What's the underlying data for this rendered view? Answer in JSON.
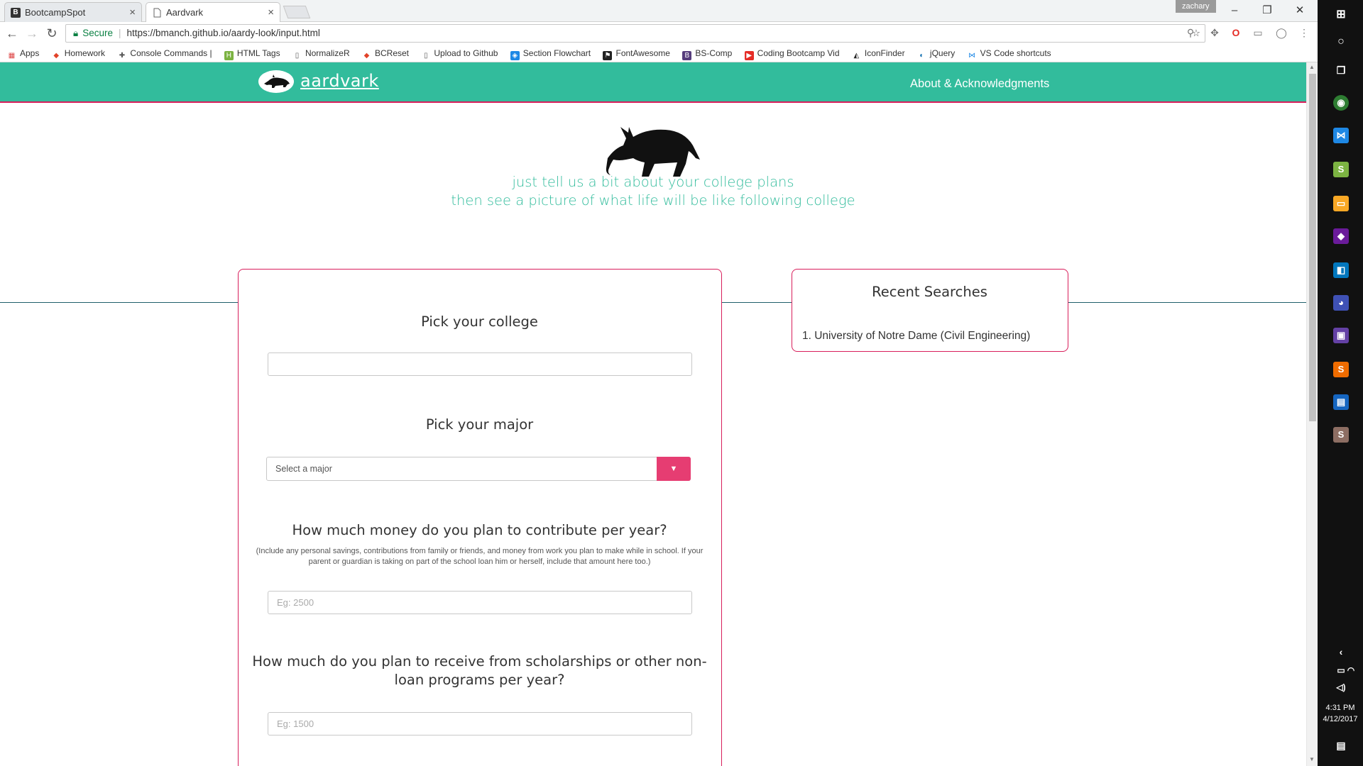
{
  "browser": {
    "tabs": [
      {
        "title": "BootcampSpot",
        "favicon": "B",
        "active": false
      },
      {
        "title": "Aardvark",
        "favicon": "page-icon",
        "active": true
      }
    ],
    "profile_name": "zachary",
    "address": {
      "secure_label": "Secure",
      "url": "https://bmanch.github.io/aardy-look/input.html"
    },
    "bookmarks": [
      {
        "label": "Apps",
        "icon": "apps-grid-icon",
        "color": "#d44"
      },
      {
        "label": "Homework",
        "icon": "gitlab-icon",
        "color": "#e24329"
      },
      {
        "label": "Console Commands |",
        "icon": "puzzle-icon",
        "color": "#555"
      },
      {
        "label": "HTML Tags",
        "icon": "html-icon",
        "color": "#7cb342"
      },
      {
        "label": "NormalizeR",
        "icon": "page-icon",
        "color": "#555"
      },
      {
        "label": "BCReset",
        "icon": "gitlab-icon",
        "color": "#e24329"
      },
      {
        "label": "Upload to Github",
        "icon": "page-icon",
        "color": "#555"
      },
      {
        "label": "Section Flowchart",
        "icon": "draw-icon",
        "color": "#1e88e5"
      },
      {
        "label": "FontAwesome",
        "icon": "flag-icon",
        "color": "#222"
      },
      {
        "label": "BS-Comp",
        "icon": "bootstrap-icon",
        "color": "#563d7c"
      },
      {
        "label": "Coding Bootcamp Vid",
        "icon": "youtube-icon",
        "color": "#e52d27"
      },
      {
        "label": "IconFinder",
        "icon": "iconfinder-icon",
        "color": "#222"
      },
      {
        "label": "jQuery",
        "icon": "jquery-icon",
        "color": "#0769ad"
      },
      {
        "label": "VS Code shortcuts",
        "icon": "vscode-icon",
        "color": "#1e88e5"
      }
    ]
  },
  "site": {
    "brand": "aardvark",
    "nav_link": "About & Acknowledgments",
    "tagline_1": "just tell us a bit about your college plans",
    "tagline_2": "then see a picture of what life will be like following college",
    "accent_color": "#32bc9c",
    "border_color": "#d81e5b"
  },
  "form": {
    "college_label": "Pick your college",
    "college_value": "",
    "major_label": "Pick your major",
    "major_placeholder": "Select a major",
    "contribute_label": "How much money do you plan to contribute per year?",
    "contribute_note": "(Include any personal savings, contributions from family or friends, and money from work you plan to make while in school. If your parent or guardian is taking on part of the school loan him or herself, include that amount here too.)",
    "contribute_placeholder": "Eg: 2500",
    "scholarship_label": "How much do you plan to receive from scholarships or other non-loan programs per year?",
    "scholarship_placeholder": "Eg: 1500"
  },
  "recent": {
    "title": "Recent Searches",
    "items": [
      "1. University of Notre Dame (Civil Engineering)"
    ]
  },
  "taskbar": {
    "time": "4:31 PM",
    "date": "4/12/2017"
  }
}
